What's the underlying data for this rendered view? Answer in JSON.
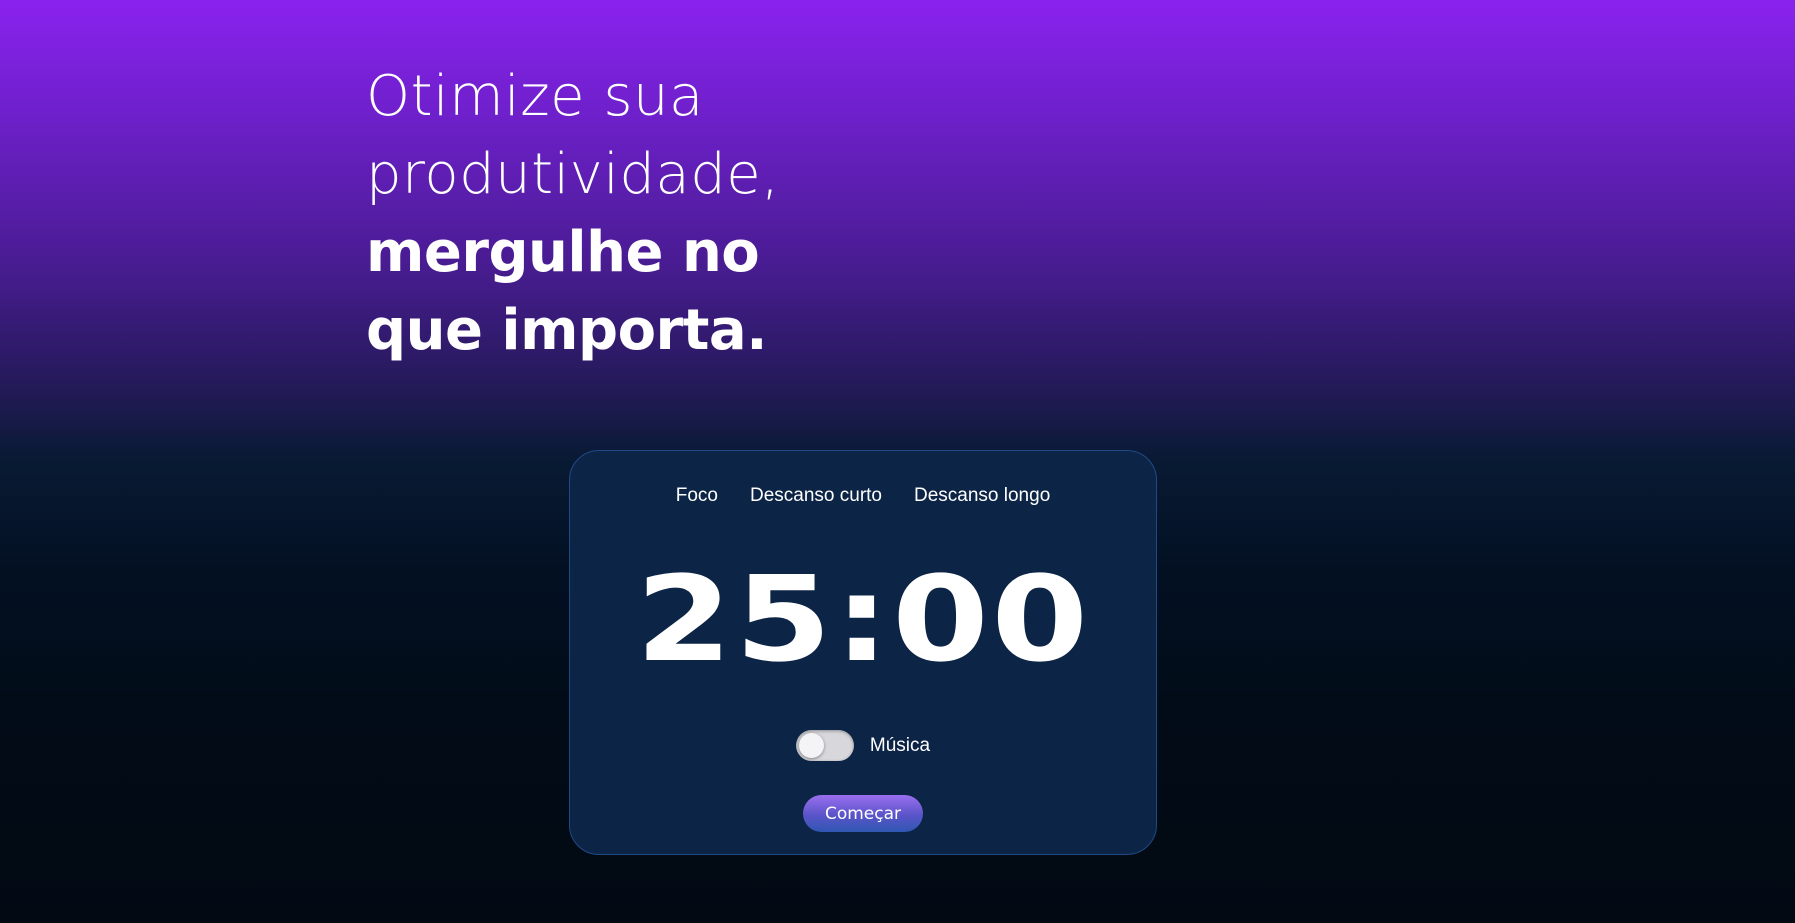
{
  "hero": {
    "line1": "Otimize sua",
    "line2": "produtividade,",
    "line3": "mergulhe no",
    "line4": "que importa."
  },
  "timer": {
    "tabs": [
      {
        "label": "Foco"
      },
      {
        "label": "Descanso curto"
      },
      {
        "label": "Descanso longo"
      }
    ],
    "display": "25:00",
    "music_label": "Música",
    "music_enabled": false,
    "start_label": "Começar"
  },
  "colors": {
    "gradient_top": "#8a22ee",
    "gradient_bottom": "#020913",
    "card_background": "#0c2445",
    "card_border": "#1f4a86",
    "button_gradient_start": "#9b6ff0",
    "button_gradient_end": "#2f57b2"
  }
}
